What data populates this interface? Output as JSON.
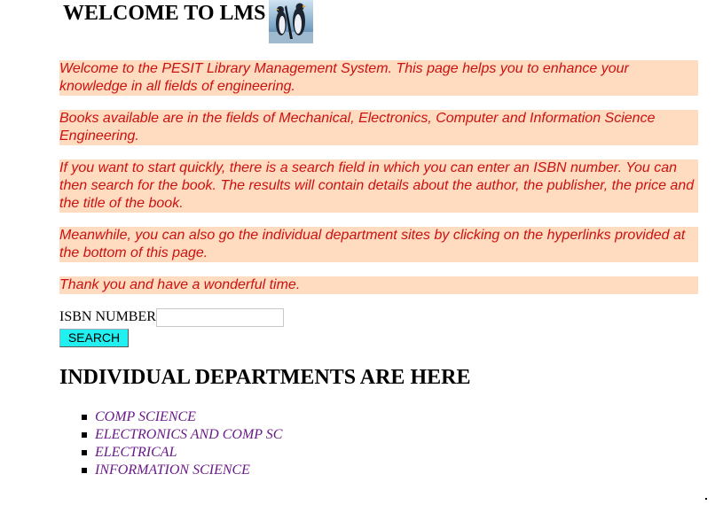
{
  "header": {
    "title": "WELCOME TO LMS",
    "logo_icon": "penguins-logo-icon"
  },
  "paragraphs": [
    "Welcome to the PESIT Library Management System. This page helps you to enhance your knowledge in all fields of engineering.",
    "Books available are in the fields of Mechanical, Electronics, Computer and Information Science Engineering.",
    "If you want to start quickly, there is a search field in which you can enter an ISBN number. You can then search for the book. The results will contain details about the author, the publisher, the price and the title of the book.",
    "Meanwhile, you can also go the individual department sites by clicking on the hyperlinks provided at the bottom of this page.",
    "Thank you and have a wonderful time."
  ],
  "search": {
    "label": "ISBN NUMBER",
    "value": "",
    "placeholder": "",
    "button_label": "SEARCH"
  },
  "departments": {
    "heading": "INDIVIDUAL DEPARTMENTS ARE HERE",
    "links": [
      "COMP SCIENCE",
      "ELECTRONICS AND COMP SC",
      "ELECTRICAL",
      "INFORMATION SCIENCE"
    ]
  },
  "colors": {
    "paragraph_background": "#ffdcc0",
    "paragraph_text": "#cc1111",
    "search_button": "#22f0f0",
    "link_visited": "#6a1a8a"
  }
}
